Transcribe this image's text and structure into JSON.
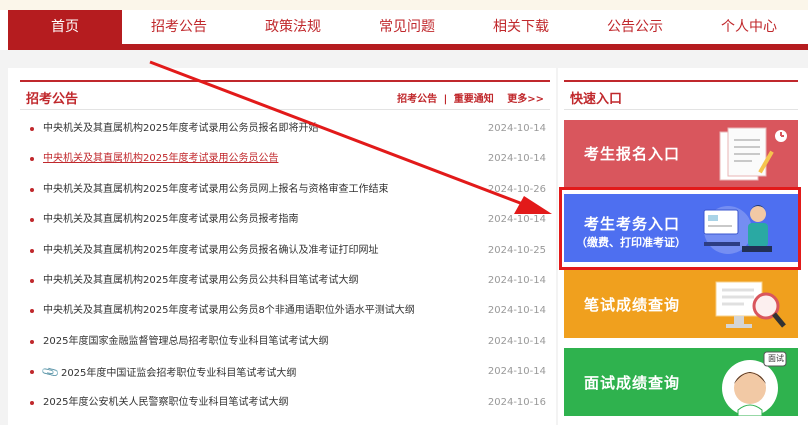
{
  "nav": {
    "items": [
      {
        "label": "首页",
        "active": true
      },
      {
        "label": "招考公告"
      },
      {
        "label": "政策法规"
      },
      {
        "label": "常见问题"
      },
      {
        "label": "相关下载"
      },
      {
        "label": "公告公示"
      },
      {
        "label": "个人中心"
      }
    ]
  },
  "announcements": {
    "title": "招考公告",
    "link_1": "招考公告",
    "separator": "|",
    "link_2": "重要通知",
    "more": "更多>>",
    "items": [
      {
        "title": "中央机关及其直属机构2025年度考试录用公务员报名即将开始",
        "date": "2024-10-14"
      },
      {
        "title": "中央机关及其直属机构2025年度考试录用公务员公告",
        "date": "2024-10-14",
        "highlight": true
      },
      {
        "title": "中央机关及其直属机构2025年度考试录用公务员网上报名与资格审查工作结束",
        "date": "2024-10-26"
      },
      {
        "title": "中央机关及其直属机构2025年度考试录用公务员报考指南",
        "date": "2024-10-14"
      },
      {
        "title": "中央机关及其直属机构2025年度考试录用公务员报名确认及准考证打印网址",
        "date": "2024-10-25"
      },
      {
        "title": "中央机关及其直属机构2025年度考试录用公务员公共科目笔试考试大纲",
        "date": "2024-10-14"
      },
      {
        "title": "中央机关及其直属机构2025年度考试录用公务员8个非通用语职位外语水平测试大纲",
        "date": "2024-10-14"
      },
      {
        "title": "2025年度国家金融监督管理总局招考职位专业科目笔试考试大纲",
        "date": "2024-10-14"
      },
      {
        "title": "2025年度中国证监会招考职位专业科目笔试考试大纲",
        "date": "2024-10-14",
        "clip": true
      },
      {
        "title": "2025年度公安机关人民警察职位专业科目笔试考试大纲",
        "date": "2024-10-16"
      }
    ]
  },
  "quick": {
    "title": "快速入口",
    "cards": [
      {
        "label": "考生报名入口"
      },
      {
        "label": "考生考务入口",
        "sub": "（缴费、打印准考证）"
      },
      {
        "label": "笔试成绩查询"
      },
      {
        "label": "面试成绩查询",
        "badge": "面试"
      }
    ]
  },
  "colors": {
    "brand_red": "#b51c1f",
    "card_register": "#d9565d",
    "card_exam": "#4e6ff0",
    "card_written": "#f0a01e",
    "card_interview": "#2fb24e",
    "annotation": "#e21a1a"
  }
}
